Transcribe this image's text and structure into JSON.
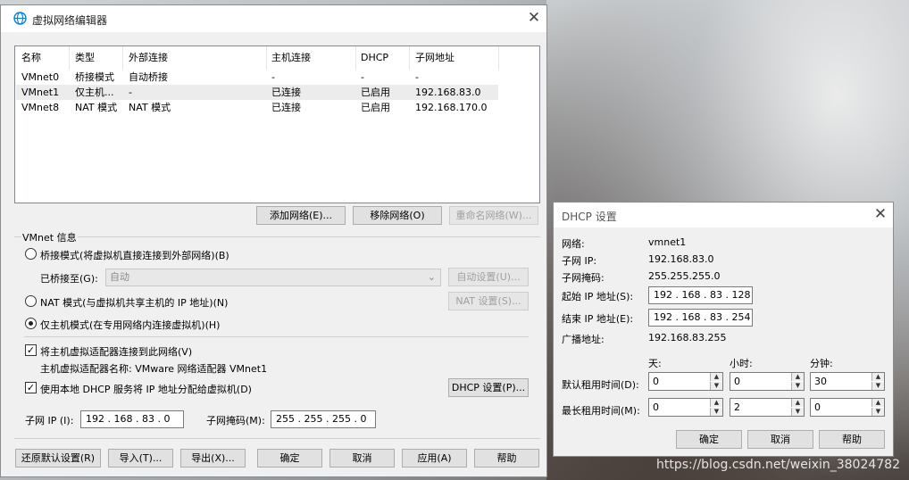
{
  "main_window": {
    "title": "虚拟网络编辑器",
    "columns": [
      "名称",
      "类型",
      "外部连接",
      "主机连接",
      "DHCP",
      "子网地址"
    ],
    "rows": [
      {
        "name": "VMnet0",
        "type": "桥接模式",
        "external": "自动桥接",
        "host": "-",
        "dhcp": "-",
        "subnet": "-"
      },
      {
        "name": "VMnet1",
        "type": "仅主机...",
        "external": "-",
        "host": "已连接",
        "dhcp": "已启用",
        "subnet": "192.168.83.0"
      },
      {
        "name": "VMnet8",
        "type": "NAT 模式",
        "external": "NAT 模式",
        "host": "已连接",
        "dhcp": "已启用",
        "subnet": "192.168.170.0"
      }
    ],
    "add_network_label": "添加网络(E)...",
    "remove_network_label": "移除网络(O)",
    "rename_network_label": "重命名网络(W)...",
    "vmnet_info_label": "VMnet 信息",
    "bridge_mode_label": "桥接模式(将虚拟机直接连接到外部网络)(B)",
    "bridged_to_label": "已桥接至(G):",
    "bridged_to_value": "自动",
    "auto_settings_label": "自动设置(U)...",
    "nat_mode_label": "NAT 模式(与虚拟机共享主机的 IP 地址)(N)",
    "nat_settings_label": "NAT 设置(S)...",
    "host_only_label": "仅主机模式(在专用网络内连接虚拟机)(H)",
    "connect_adapter_label": "将主机虚拟适配器连接到此网络(V)",
    "adapter_name_label": "主机虚拟适配器名称: VMware 网络适配器 VMnet1",
    "use_dhcp_label": "使用本地 DHCP 服务将 IP 地址分配给虚拟机(D)",
    "dhcp_settings_label": "DHCP 设置(P)...",
    "subnet_ip_label": "子网 IP (I):",
    "subnet_ip_value": "192 . 168 . 83 . 0",
    "subnet_mask_label": "子网掩码(M):",
    "subnet_mask_value": "255 . 255 . 255 . 0",
    "restore_defaults_label": "还原默认设置(R)",
    "import_label": "导入(T)...",
    "export_label": "导出(X)...",
    "ok_label": "确定",
    "cancel_label": "取消",
    "apply_label": "应用(A)",
    "help_label": "帮助",
    "selected_mode": "host_only",
    "connect_adapter_checked": true,
    "use_dhcp_checked": true
  },
  "dhcp_window": {
    "title": "DHCP 设置",
    "network_label": "网络:",
    "network_value": "vmnet1",
    "subnet_ip_label": "子网 IP:",
    "subnet_ip_value": "192.168.83.0",
    "subnet_mask_label": "子网掩码:",
    "subnet_mask_value": "255.255.255.0",
    "start_ip_label": "起始 IP 地址(S):",
    "start_ip_value": "192 . 168 . 83 . 128",
    "end_ip_label": "结束 IP 地址(E):",
    "end_ip_value": "192 . 168 . 83 . 254",
    "broadcast_label": "广播地址:",
    "broadcast_value": "192.168.83.255",
    "days_label": "天:",
    "hours_label": "小时:",
    "minutes_label": "分钟:",
    "default_lease_label": "默认租用时间(D):",
    "default_lease": {
      "days": "0",
      "hours": "0",
      "minutes": "30"
    },
    "max_lease_label": "最长租用时间(M):",
    "max_lease": {
      "days": "0",
      "hours": "2",
      "minutes": "0"
    },
    "ok_label": "确定",
    "cancel_label": "取消",
    "help_label": "帮助"
  },
  "watermark": "https://blog.csdn.net/weixin_38024782",
  "colors": {
    "accent": "#0078d7",
    "window_bg": "#f0f0f0"
  }
}
